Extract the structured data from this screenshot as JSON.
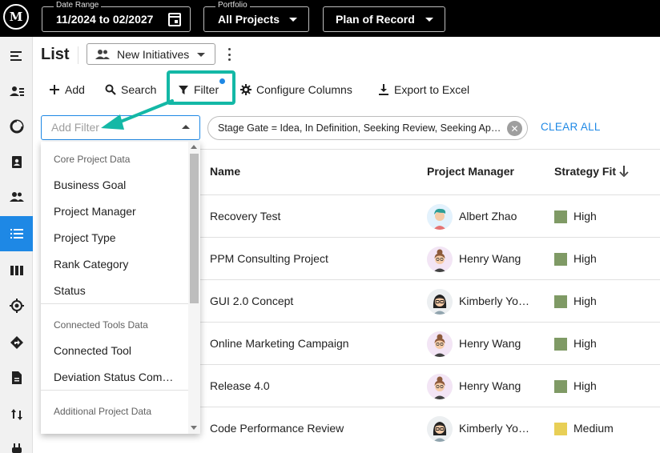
{
  "topbar": {
    "logo": "M",
    "date_range": {
      "caption": "Date Range",
      "value": "11/2024 to 02/2027"
    },
    "portfolio": {
      "caption": "Portfolio",
      "value": "All Projects"
    },
    "plan": {
      "value": "Plan of Record"
    }
  },
  "sidebar": {
    "icons": [
      "menu-icon",
      "user-list-icon",
      "pie-chart-icon",
      "badge-icon",
      "people-icon",
      "list-icon",
      "columns-icon",
      "target-icon",
      "direction-icon",
      "document-icon",
      "swap-icon",
      "plug-icon"
    ],
    "active_index": 5,
    "active_color": "#1e88e5"
  },
  "header": {
    "title": "List",
    "view": "New Initiatives"
  },
  "toolbar": {
    "add": "Add",
    "search": "Search",
    "filter": "Filter",
    "configure": "Configure Columns",
    "export": "Export to Excel",
    "highlight_color": "#14b8a6"
  },
  "filters": {
    "placeholder": "Add Filter",
    "chip": "Stage Gate = Idea, In Definition, Seeking Review, Seeking Approval",
    "clear_all": "CLEAR ALL"
  },
  "dropdown": {
    "groups": [
      {
        "title": "Core Project Data",
        "items": [
          "Business Goal",
          "Project Manager",
          "Project Type",
          "Rank Category",
          "Status"
        ]
      },
      {
        "title": "Connected Tools Data",
        "items": [
          "Connected Tool",
          "Deviation Status Comment"
        ]
      },
      {
        "title": "Additional Project Data",
        "items": []
      }
    ]
  },
  "table": {
    "columns": [
      "Name",
      "Project Manager",
      "Strategy Fit"
    ],
    "sort_column": "Strategy Fit",
    "rows": [
      {
        "name": "Recovery Test",
        "pm": "Albert Zhao",
        "fit": "High",
        "fit_color": "#7f9a65",
        "avatar": "male"
      },
      {
        "name": "PPM Consulting Project",
        "pm": "Henry Wang",
        "fit": "High",
        "fit_color": "#7f9a65",
        "avatar": "bun"
      },
      {
        "name": "GUI 2.0 Concept",
        "pm": "Kimberly Young",
        "fit": "High",
        "fit_color": "#7f9a65",
        "avatar": "glasses"
      },
      {
        "name": "Online Marketing Campaign",
        "pm": "Henry Wang",
        "fit": "High",
        "fit_color": "#7f9a65",
        "avatar": "bun"
      },
      {
        "name": "Release 4.0",
        "pm": "Henry Wang",
        "fit": "High",
        "fit_color": "#7f9a65",
        "avatar": "bun"
      },
      {
        "name": "Code Performance Review",
        "pm": "Kimberly Young",
        "fit": "Medium",
        "fit_color": "#e8cf56",
        "avatar": "glasses"
      }
    ]
  }
}
